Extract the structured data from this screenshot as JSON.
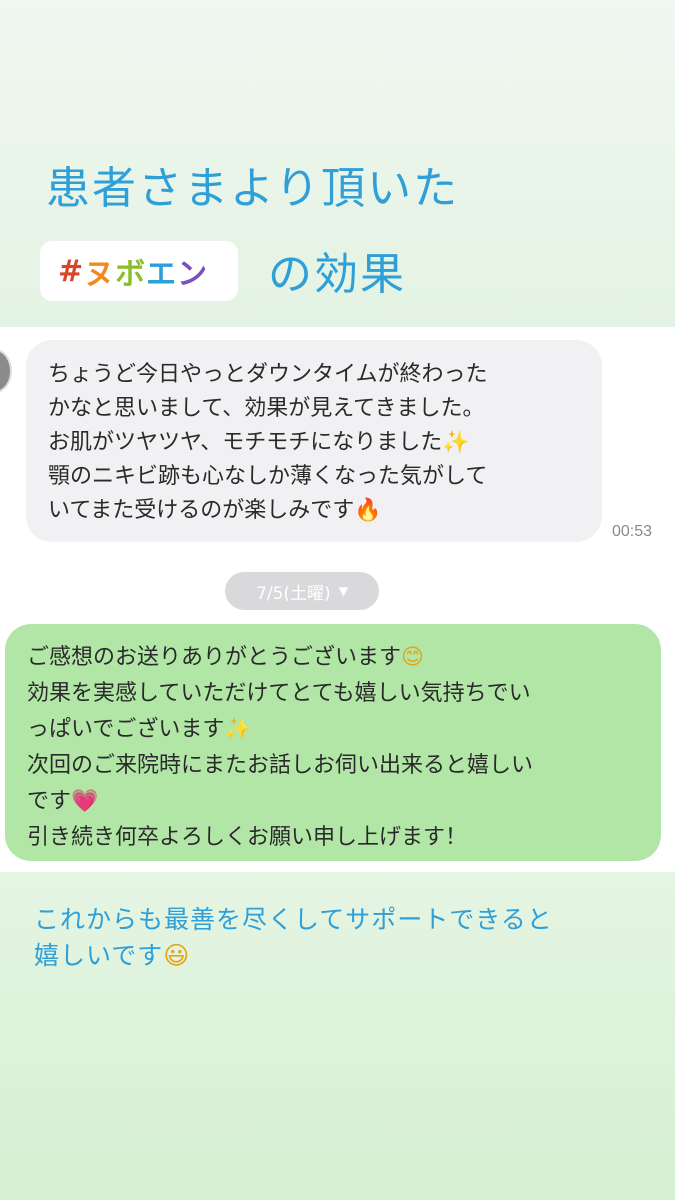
{
  "header": {
    "title_line1": "患者さまより頂いた",
    "hashtag": {
      "chars": [
        {
          "ch": "#",
          "color": "#d9472b"
        },
        {
          "ch": "ヌ",
          "color": "#f08a1e"
        },
        {
          "ch": "ボ",
          "color": "#8bbf2a"
        },
        {
          "ch": "エ",
          "color": "#2a9fd8"
        },
        {
          "ch": "ン",
          "color": "#7a4fc0"
        }
      ]
    },
    "title_line2": "の効果"
  },
  "incoming_message": {
    "lines": [
      "ちょうど今日やっとダウンタイムが終わった",
      "かなと思いまして、効果が見えてきました。",
      "お肌がツヤツヤ、モチモチになりました",
      "顎のニキビ跡も心なしか薄くなった気がして",
      "いてまた受けるのが楽しみです"
    ],
    "line3_emoji": "✨",
    "line5_emoji": "🔥",
    "time": "00:53"
  },
  "date_divider": {
    "label": "7/5(土曜)",
    "caret": "▼"
  },
  "outgoing_message": {
    "lines": [
      "ご感想のお送りありがとうございます",
      "効果を実感していただけてとても嬉しい気持ちでい",
      "っぱいでございます",
      "次回のご来院時にまたお話しお伺い出来ると嬉しい",
      "です",
      "引き続き何卒よろしくお願い申し上げます！"
    ],
    "line1_emoji": "😊",
    "line3_emoji": "✨",
    "line5_emoji": "💗"
  },
  "footer": {
    "lines": [
      "これからも最善を尽くしてサポートできると",
      "嬉しいです"
    ],
    "line2_emoji": "😃"
  },
  "colors": {
    "title": "#2f9fd8",
    "outgoing_bubble": "#b2e6a7",
    "incoming_bubble": "#f1f1f3",
    "date_pill": "#d9d9dc"
  }
}
